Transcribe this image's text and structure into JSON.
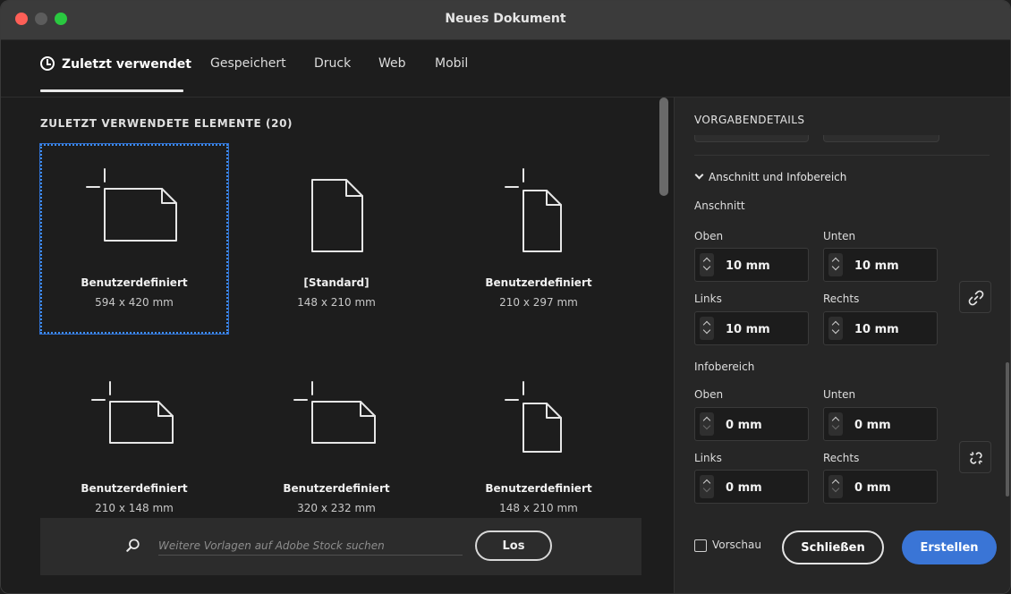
{
  "window": {
    "title": "Neues Dokument"
  },
  "tabs": [
    {
      "label": "Zuletzt verwendet",
      "active": true
    },
    {
      "label": "Gespeichert"
    },
    {
      "label": "Druck"
    },
    {
      "label": "Web"
    },
    {
      "label": "Mobil"
    }
  ],
  "recent": {
    "heading": "ZULETZT VERWENDETE ELEMENTE  (20)",
    "items": [
      {
        "name": "Benutzerdefiniert",
        "size": "594 x 420 mm",
        "icon": "landscape-artboard-icon"
      },
      {
        "name": "[Standard]",
        "size": "148 x 210 mm",
        "icon": "portrait-document-icon"
      },
      {
        "name": "Benutzerdefiniert",
        "size": "210 x 297 mm",
        "icon": "portrait-artboard-icon"
      },
      {
        "name": "Benutzerdefiniert",
        "size": "210 x 148 mm",
        "icon": "landscape-artboard-icon"
      },
      {
        "name": "Benutzerdefiniert",
        "size": "320 x 232 mm",
        "icon": "landscape-artboard-icon"
      },
      {
        "name": "Benutzerdefiniert",
        "size": "148 x 210 mm",
        "icon": "portrait-artboard-icon"
      }
    ]
  },
  "search": {
    "placeholder": "Weitere Vorlagen auf Adobe Stock suchen",
    "value": "",
    "button_label": "Los"
  },
  "preset": {
    "title": "VORGABENDETAILS",
    "section_label": "Anschnitt und Infobereich",
    "bleed": {
      "label": "Anschnitt",
      "top_label": "Oben",
      "top": "10 mm",
      "bottom_label": "Unten",
      "bottom": "10 mm",
      "left_label": "Links",
      "left": "10 mm",
      "right_label": "Rechts",
      "right": "10 mm",
      "linked": true
    },
    "slug": {
      "label": "Infobereich",
      "top_label": "Oben",
      "top": "0 mm",
      "bottom_label": "Unten",
      "bottom": "0 mm",
      "left_label": "Links",
      "left": "0 mm",
      "right_label": "Rechts",
      "right": "0 mm",
      "linked": false
    }
  },
  "footer": {
    "preview_label": "Vorschau",
    "preview_checked": false,
    "close_label": "Schließen",
    "create_label": "Erstellen"
  },
  "colors": {
    "accent": "#3a75d6",
    "selection": "#3f8cf0"
  }
}
